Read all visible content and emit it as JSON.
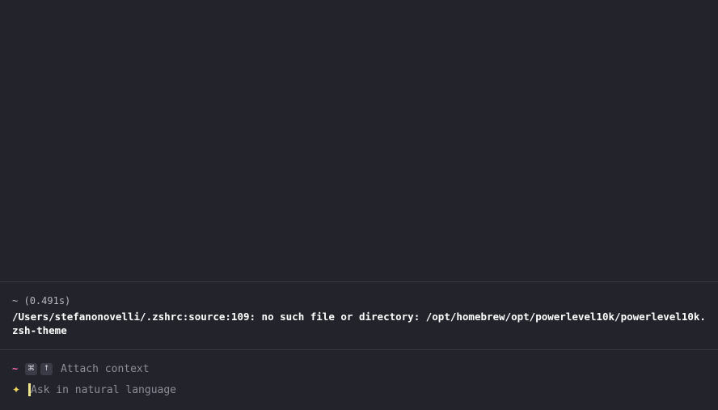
{
  "block": {
    "prompt_dir": "~",
    "duration": "(0.491s)",
    "output": "/Users/stefanonovelli/.zshrc:source:109: no such file or directory: /opt/homebrew/opt/powerlevel10k/powerlevel10k.zsh-theme"
  },
  "prompt": {
    "dir": "~",
    "keys": [
      "⌘",
      "↑"
    ],
    "attach_label": "Attach context",
    "ai_icon": "sparkle-icon",
    "ask_placeholder": "Ask in natural language"
  },
  "colors": {
    "background": "#23232c",
    "prompt_dir": "#ff69b4",
    "cursor": "#f0e68c",
    "muted_text": "#8d8d98"
  }
}
